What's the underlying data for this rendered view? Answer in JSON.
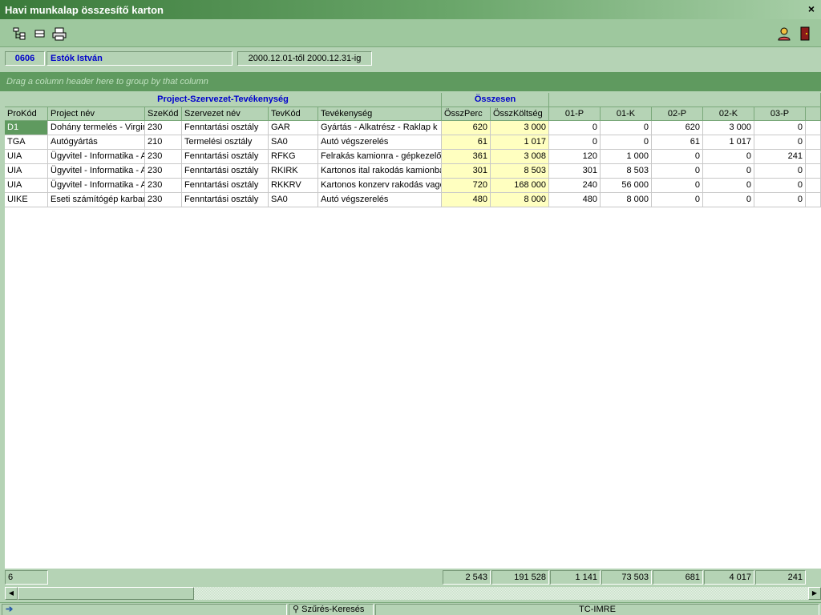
{
  "window": {
    "title": "Havi munkalap összesítő karton",
    "close_label": "×"
  },
  "toolbar": {
    "left_icons": [
      "tree-icon",
      "collapse-icon",
      "print-icon"
    ],
    "right_icons": [
      "users-icon",
      "exit-icon"
    ]
  },
  "info": {
    "code": "0606",
    "name": "Estók István",
    "period": "2000.12.01-től 2000.12.31-ig"
  },
  "grouppanel": {
    "hint": "Drag a column header here to group by that column"
  },
  "grid": {
    "bands": {
      "project": "Project-Szervezet-Tevékenység",
      "total": "Összesen"
    },
    "headers": {
      "prokod": "ProKód",
      "projectnev": "Project név",
      "szekod": "SzeKód",
      "szervezetnev": "Szervezet név",
      "tevkod": "TevKód",
      "tevekenyseg": "Tevékenység",
      "osszperc": "ÖsszPerc",
      "osszkoltseg": "ÖsszKöltség",
      "p01": "01-P",
      "k01": "01-K",
      "p02": "02-P",
      "k02": "02-K",
      "p03": "03-P"
    },
    "rows": [
      {
        "prokod": "D1",
        "projectnev": "Dohány termelés - Virginia",
        "szekod": "230",
        "szervezetnev": "Fenntartási osztály",
        "tevkod": "GAR",
        "tevekenyseg": "Gyártás - Alkatrész - Raklap k",
        "osszperc": "620",
        "osszkoltseg": "3 000",
        "p01": "0",
        "k01": "0",
        "p02": "620",
        "k02": "3 000",
        "p03": "0"
      },
      {
        "prokod": "TGA",
        "projectnev": "Autógyártás",
        "szekod": "210",
        "szervezetnev": "Termelési osztály",
        "tevkod": "SA0",
        "tevekenyseg": "Autó végszerelés",
        "osszperc": "61",
        "osszkoltseg": "1 017",
        "p01": "0",
        "k01": "0",
        "p02": "61",
        "k02": "1 017",
        "p03": "0"
      },
      {
        "prokod": "UIA",
        "projectnev": "Ügyvitel - Informatika - A",
        "szekod": "230",
        "szervezetnev": "Fenntartási osztály",
        "tevkod": "RFKG",
        "tevekenyseg": "Felrakás kamionra - gépkezelő",
        "osszperc": "361",
        "osszkoltseg": "3 008",
        "p01": "120",
        "k01": "1 000",
        "p02": "0",
        "k02": "0",
        "p03": "241"
      },
      {
        "prokod": "UIA",
        "projectnev": "Ügyvitel - Informatika - A",
        "szekod": "230",
        "szervezetnev": "Fenntartási osztály",
        "tevkod": "RKIRK",
        "tevekenyseg": "Kartonos ital rakodás kamionba",
        "osszperc": "301",
        "osszkoltseg": "8 503",
        "p01": "301",
        "k01": "8 503",
        "p02": "0",
        "k02": "0",
        "p03": "0"
      },
      {
        "prokod": "UIA",
        "projectnev": "Ügyvitel - Informatika - A",
        "szekod": "230",
        "szervezetnev": "Fenntartási osztály",
        "tevkod": "RKKRV",
        "tevekenyseg": "Kartonos konzerv rakodás vagon",
        "osszperc": "720",
        "osszkoltseg": "168 000",
        "p01": "240",
        "k01": "56 000",
        "p02": "0",
        "k02": "0",
        "p03": "0"
      },
      {
        "prokod": "UIKE",
        "projectnev": "Eseti számítógép karbantartás",
        "szekod": "230",
        "szervezetnev": "Fenntartási osztály",
        "tevkod": "SA0",
        "tevekenyseg": "Autó végszerelés",
        "osszperc": "480",
        "osszkoltseg": "8 000",
        "p01": "480",
        "k01": "8 000",
        "p02": "0",
        "k02": "0",
        "p03": "0"
      }
    ]
  },
  "footer": {
    "count": "6",
    "osszperc": "2 543",
    "osszkoltseg": "191 528",
    "p01": "1 141",
    "k01": "73 503",
    "p02": "681",
    "k02": "4 017",
    "p03": "241"
  },
  "statusbar": {
    "filter_label": "Szűrés-Keresés",
    "user": "TC-IMRE"
  }
}
